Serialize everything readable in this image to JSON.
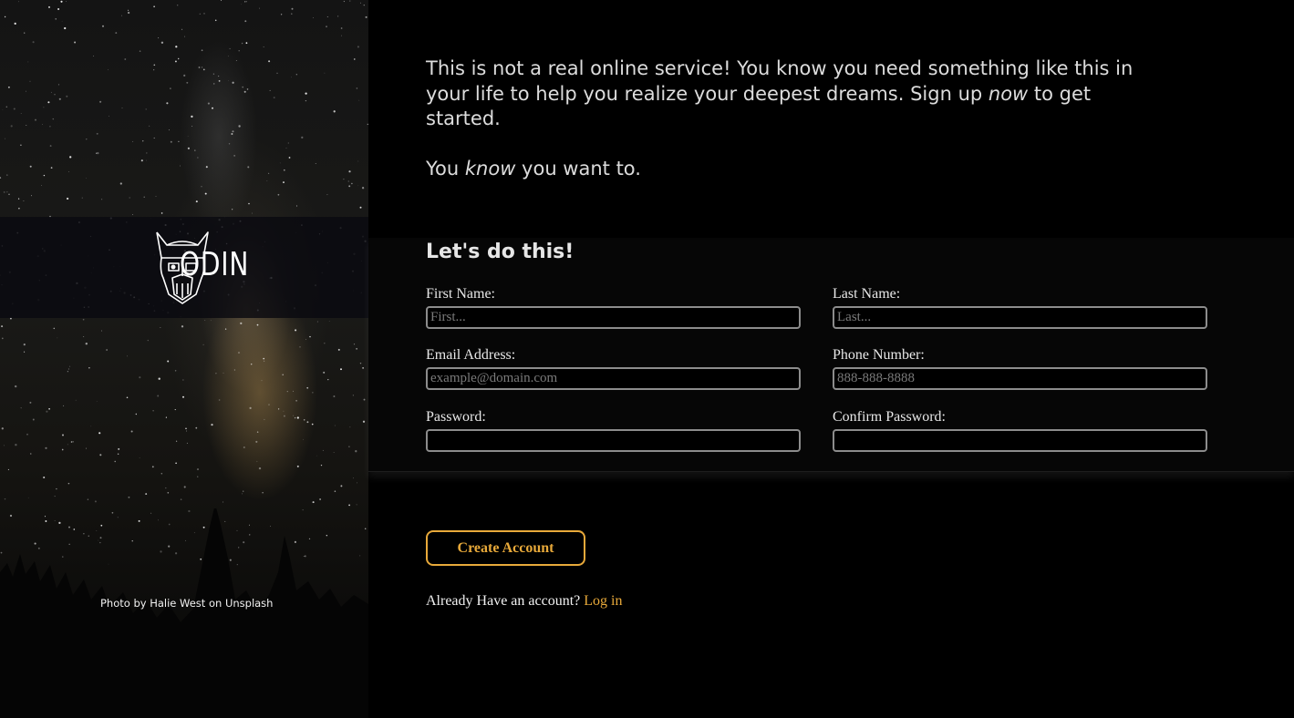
{
  "brand": {
    "name": "ODIN",
    "logo_icon": "viking-helmet-icon"
  },
  "hero": {
    "credit": "Photo by Halie West on Unsplash"
  },
  "intro": {
    "paragraph1_before": "This is not a real online service! You know you need something like this in your life to help you realize your deepest dreams. Sign up ",
    "paragraph1_emphasis": "now",
    "paragraph1_after": " to get started.",
    "paragraph2_before": "You ",
    "paragraph2_emphasis": "know",
    "paragraph2_after": " you want to."
  },
  "form": {
    "title": "Let's do this!",
    "first_name": {
      "label": "First Name:",
      "placeholder": "First...",
      "value": ""
    },
    "last_name": {
      "label": "Last Name:",
      "placeholder": "Last...",
      "value": ""
    },
    "email": {
      "label": "Email Address:",
      "placeholder": "example@domain.com",
      "value": ""
    },
    "phone": {
      "label": "Phone Number:",
      "placeholder": "888-888-8888",
      "value": ""
    },
    "password": {
      "label": "Password:",
      "placeholder": "",
      "value": ""
    },
    "confirm_password": {
      "label": "Confirm Password:",
      "placeholder": "",
      "value": ""
    }
  },
  "actions": {
    "create_account": "Create Account",
    "login_prompt": "Already Have an account?",
    "login_link": "Log in"
  },
  "colors": {
    "accent": "#e8a93a",
    "background": "#000000",
    "band": "#060606"
  }
}
